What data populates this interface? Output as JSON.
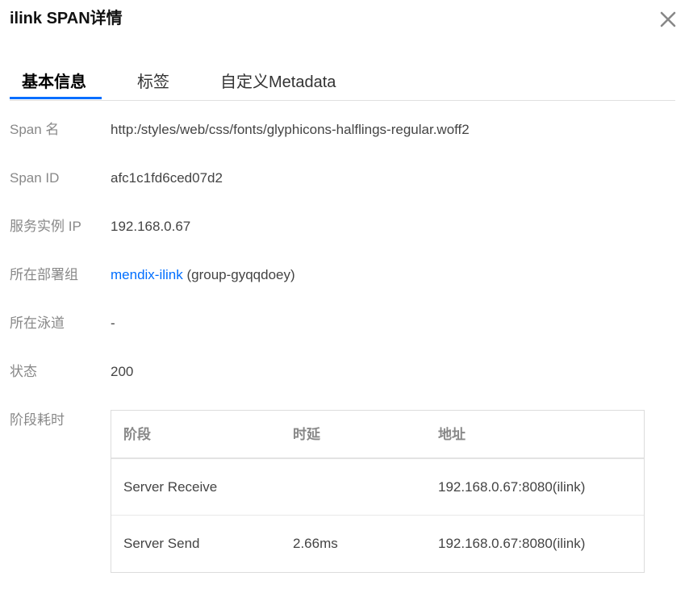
{
  "dialog": {
    "title": "ilink SPAN详情",
    "close_icon": "close-icon"
  },
  "tabs": [
    {
      "label": "基本信息",
      "active": true
    },
    {
      "label": "标签",
      "active": false
    },
    {
      "label": "自定义Metadata",
      "active": false
    }
  ],
  "fields": {
    "span_name": {
      "label": "Span 名",
      "value": "http:/styles/web/css/fonts/glyphicons-halflings-regular.woff2"
    },
    "span_id": {
      "label": "Span ID",
      "value": "afc1c1fd6ced07d2"
    },
    "instance_ip": {
      "label": "服务实例 IP",
      "value": "192.168.0.67"
    },
    "deploy_group": {
      "label": "所在部署组",
      "link": "mendix-ilink",
      "suffix": " (group-gyqqdoey)"
    },
    "lane": {
      "label": "所在泳道",
      "value": "-"
    },
    "status": {
      "label": "状态",
      "value": "200"
    },
    "stage_timing": {
      "label": "阶段耗时"
    }
  },
  "stage_table": {
    "columns": [
      "阶段",
      "时延",
      "地址"
    ],
    "rows": [
      {
        "stage": "Server Receive",
        "latency": "",
        "address": "192.168.0.67:8080(ilink)"
      },
      {
        "stage": "Server Send",
        "latency": "2.66ms",
        "address": "192.168.0.67:8080(ilink)"
      }
    ]
  },
  "colors": {
    "accent": "#006eff",
    "label": "#888888",
    "text": "#444444"
  }
}
